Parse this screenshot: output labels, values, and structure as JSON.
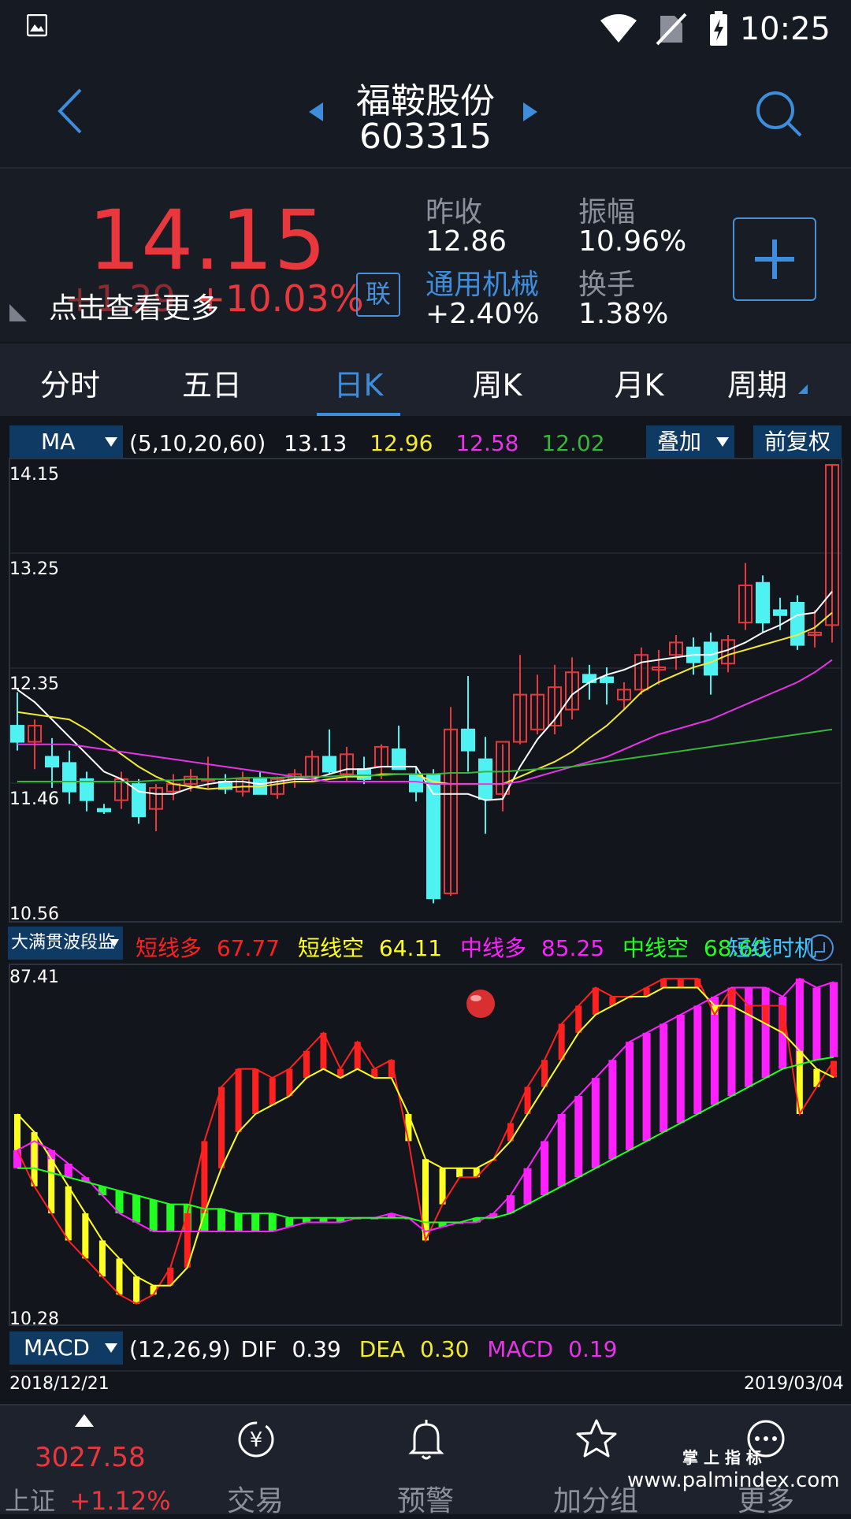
{
  "status": {
    "time": "10:25"
  },
  "header": {
    "name": "福鞍股份",
    "code": "603315"
  },
  "quote": {
    "price": "14.15",
    "change": "+1.29",
    "change_pct": "+10.03%",
    "tip": "点击查看更多",
    "lian": "联",
    "prev_close_label": "昨收",
    "prev_close": "12.86",
    "amplitude_label": "振幅",
    "amplitude": "10.96%",
    "sector": "通用机械",
    "sector_pct": "+2.40%",
    "turnover_label": "换手",
    "turnover": "1.38%",
    "colors": {
      "up": "#e8383d",
      "accent": "#3e8ddc"
    }
  },
  "tabs": [
    {
      "label": "分时"
    },
    {
      "label": "五日"
    },
    {
      "label": "日K",
      "active": true
    },
    {
      "label": "周K"
    },
    {
      "label": "月K"
    },
    {
      "label": "周期"
    }
  ],
  "ma": {
    "selector": "MA",
    "params": "(5,10,20,60)",
    "v5": "13.13",
    "v10": "12.96",
    "v20": "12.58",
    "v60": "12.02",
    "overlay": "叠加",
    "adjust": "前复权"
  },
  "indicator": {
    "selector": "大满贯波段监",
    "items": [
      {
        "label": "短线多",
        "value": "67.77",
        "color": "#ff2020"
      },
      {
        "label": "短线空",
        "value": "64.11",
        "color": "#ffff20"
      },
      {
        "label": "中线多",
        "value": "85.25",
        "color": "#ff20ff"
      },
      {
        "label": "中线空",
        "value": "68.60",
        "color": "#20ff20"
      }
    ],
    "extra": "短线时机"
  },
  "macd": {
    "selector": "MACD",
    "params": "(12,26,9)",
    "dif_label": "DIF",
    "dif": "0.39",
    "dea_label": "DEA",
    "dea": "0.30",
    "macd_label": "MACD",
    "macd": "0.19"
  },
  "chart_data": [
    {
      "type": "candlestick",
      "y_ticks": [
        "14.15",
        "13.25",
        "12.35",
        "11.46",
        "10.56"
      ],
      "ylim": [
        10.56,
        14.15
      ],
      "x_start": "2018/12/21",
      "x_end": "2019/03/04",
      "candles": [
        {
          "o": 12.05,
          "h": 12.32,
          "l": 11.85,
          "c": 11.92
        },
        {
          "o": 11.92,
          "h": 12.1,
          "l": 11.7,
          "c": 12.05
        },
        {
          "o": 11.8,
          "h": 11.95,
          "l": 11.55,
          "c": 11.72
        },
        {
          "o": 11.75,
          "h": 11.85,
          "l": 11.42,
          "c": 11.52
        },
        {
          "o": 11.62,
          "h": 11.68,
          "l": 11.36,
          "c": 11.45
        },
        {
          "o": 11.38,
          "h": 11.42,
          "l": 11.34,
          "c": 11.36
        },
        {
          "o": 11.45,
          "h": 11.68,
          "l": 11.38,
          "c": 11.62
        },
        {
          "o": 11.58,
          "h": 11.62,
          "l": 11.26,
          "c": 11.32
        },
        {
          "o": 11.38,
          "h": 11.58,
          "l": 11.2,
          "c": 11.55
        },
        {
          "o": 11.52,
          "h": 11.66,
          "l": 11.45,
          "c": 11.58
        },
        {
          "o": 11.58,
          "h": 11.7,
          "l": 11.52,
          "c": 11.64
        },
        {
          "o": 11.62,
          "h": 11.8,
          "l": 11.55,
          "c": 11.62
        },
        {
          "o": 11.6,
          "h": 11.66,
          "l": 11.5,
          "c": 11.54
        },
        {
          "o": 11.52,
          "h": 11.68,
          "l": 11.48,
          "c": 11.62
        },
        {
          "o": 11.62,
          "h": 11.68,
          "l": 11.5,
          "c": 11.5
        },
        {
          "o": 11.5,
          "h": 11.64,
          "l": 11.46,
          "c": 11.62
        },
        {
          "o": 11.62,
          "h": 11.7,
          "l": 11.55,
          "c": 11.66
        },
        {
          "o": 11.64,
          "h": 11.85,
          "l": 11.6,
          "c": 11.8
        },
        {
          "o": 11.8,
          "h": 12.02,
          "l": 11.66,
          "c": 11.68
        },
        {
          "o": 11.66,
          "h": 11.88,
          "l": 11.6,
          "c": 11.82
        },
        {
          "o": 11.7,
          "h": 11.8,
          "l": 11.58,
          "c": 11.62
        },
        {
          "o": 11.72,
          "h": 11.9,
          "l": 11.62,
          "c": 11.88
        },
        {
          "o": 11.86,
          "h": 12.05,
          "l": 11.72,
          "c": 11.7
        },
        {
          "o": 11.66,
          "h": 11.72,
          "l": 11.44,
          "c": 11.52
        },
        {
          "o": 11.66,
          "h": 11.7,
          "l": 10.62,
          "c": 10.66
        },
        {
          "o": 10.7,
          "h": 12.2,
          "l": 10.68,
          "c": 12.02
        },
        {
          "o": 12.02,
          "h": 12.45,
          "l": 11.68,
          "c": 11.85
        },
        {
          "o": 11.78,
          "h": 11.96,
          "l": 11.18,
          "c": 11.46
        },
        {
          "o": 11.5,
          "h": 11.9,
          "l": 11.36,
          "c": 11.92
        },
        {
          "o": 11.92,
          "h": 12.62,
          "l": 11.9,
          "c": 12.3
        },
        {
          "o": 12.02,
          "h": 12.46,
          "l": 11.98,
          "c": 12.3
        },
        {
          "o": 12.05,
          "h": 12.54,
          "l": 11.98,
          "c": 12.36
        },
        {
          "o": 12.18,
          "h": 12.6,
          "l": 12.1,
          "c": 12.48
        },
        {
          "o": 12.46,
          "h": 12.54,
          "l": 12.26,
          "c": 12.4
        },
        {
          "o": 12.44,
          "h": 12.52,
          "l": 12.22,
          "c": 12.4
        },
        {
          "o": 12.26,
          "h": 12.4,
          "l": 12.18,
          "c": 12.34
        },
        {
          "o": 12.34,
          "h": 12.68,
          "l": 12.3,
          "c": 12.62
        },
        {
          "o": 12.5,
          "h": 12.66,
          "l": 12.38,
          "c": 12.52
        },
        {
          "o": 12.62,
          "h": 12.78,
          "l": 12.5,
          "c": 12.72
        },
        {
          "o": 12.68,
          "h": 12.76,
          "l": 12.46,
          "c": 12.56
        },
        {
          "o": 12.72,
          "h": 12.8,
          "l": 12.3,
          "c": 12.46
        },
        {
          "o": 12.55,
          "h": 12.78,
          "l": 12.48,
          "c": 12.74
        },
        {
          "o": 12.88,
          "h": 13.36,
          "l": 12.82,
          "c": 13.18
        },
        {
          "o": 13.2,
          "h": 13.26,
          "l": 12.8,
          "c": 12.88
        },
        {
          "o": 12.98,
          "h": 13.08,
          "l": 12.82,
          "c": 12.94
        },
        {
          "o": 13.04,
          "h": 13.1,
          "l": 12.66,
          "c": 12.7
        },
        {
          "o": 12.78,
          "h": 12.98,
          "l": 12.68,
          "c": 12.8
        },
        {
          "o": 12.86,
          "h": 14.15,
          "l": 12.72,
          "c": 14.15
        }
      ],
      "ma_series": [
        {
          "name": "MA5",
          "values": [
            12.34,
            12.24,
            12.1,
            11.96,
            11.82,
            11.68,
            11.62,
            11.52,
            11.5,
            11.5,
            11.55,
            11.58,
            11.6,
            11.6,
            11.58,
            11.6,
            11.62,
            11.62,
            11.66,
            11.7,
            11.7,
            11.72,
            11.72,
            11.72,
            11.5,
            11.5,
            11.5,
            11.45,
            11.46,
            11.72,
            11.94,
            12.1,
            12.3,
            12.4,
            12.46,
            12.5,
            12.56,
            12.58,
            12.6,
            12.62,
            12.62,
            12.66,
            12.72,
            12.8,
            12.86,
            12.94,
            12.96,
            13.13
          ]
        },
        {
          "name": "MA10",
          "values": [
            12.16,
            12.14,
            12.12,
            12.1,
            12.02,
            11.92,
            11.82,
            11.72,
            11.64,
            11.58,
            11.56,
            11.54,
            11.55,
            11.56,
            11.56,
            11.58,
            11.6,
            11.6,
            11.62,
            11.64,
            11.64,
            11.66,
            11.66,
            11.66,
            11.6,
            11.58,
            11.58,
            11.58,
            11.58,
            11.64,
            11.7,
            11.76,
            11.84,
            11.95,
            12.05,
            12.18,
            12.32,
            12.4,
            12.46,
            12.52,
            12.56,
            12.62,
            12.66,
            12.7,
            12.74,
            12.78,
            12.84,
            12.96
          ]
        },
        {
          "name": "MA20",
          "values": [
            11.9,
            11.9,
            11.9,
            11.9,
            11.88,
            11.86,
            11.84,
            11.82,
            11.8,
            11.78,
            11.76,
            11.74,
            11.72,
            11.7,
            11.68,
            11.66,
            11.64,
            11.62,
            11.6,
            11.6,
            11.6,
            11.6,
            11.6,
            11.6,
            11.58,
            11.58,
            11.58,
            11.58,
            11.58,
            11.6,
            11.64,
            11.68,
            11.72,
            11.76,
            11.8,
            11.86,
            11.92,
            11.98,
            12.02,
            12.06,
            12.1,
            12.16,
            12.22,
            12.28,
            12.34,
            12.4,
            12.48,
            12.58
          ]
        },
        {
          "name": "MA60",
          "values": [
            11.6,
            11.6,
            11.6,
            11.6,
            11.6,
            11.6,
            11.6,
            11.6,
            11.61,
            11.61,
            11.62,
            11.62,
            11.62,
            11.63,
            11.63,
            11.63,
            11.64,
            11.64,
            11.64,
            11.65,
            11.65,
            11.65,
            11.66,
            11.66,
            11.66,
            11.67,
            11.67,
            11.68,
            11.68,
            11.69,
            11.7,
            11.71,
            11.72,
            11.74,
            11.76,
            11.78,
            11.8,
            11.82,
            11.84,
            11.86,
            11.88,
            11.9,
            11.92,
            11.94,
            11.96,
            11.98,
            12.0,
            12.02
          ]
        }
      ]
    },
    {
      "type": "bar",
      "title": "",
      "y_ticks": [
        "87.41",
        "10.28"
      ],
      "ylim": [
        10.28,
        87.41
      ],
      "series": [
        {
          "name": "短线多",
          "values": [
            48,
            40,
            34,
            28,
            24,
            20,
            16,
            14,
            16,
            22,
            34,
            50,
            62,
            66,
            66,
            64,
            66,
            70,
            74,
            66,
            72,
            66,
            68,
            50,
            28,
            36,
            42,
            42,
            46,
            54,
            62,
            68,
            76,
            80,
            84,
            82,
            82,
            84,
            86,
            86,
            86,
            78,
            84,
            80,
            80,
            80,
            56,
            62,
            67.77
          ]
        },
        {
          "name": "短线空",
          "values": [
            56,
            52,
            46,
            40,
            34,
            28,
            24,
            20,
            18,
            18,
            22,
            34,
            44,
            52,
            56,
            58,
            60,
            64,
            66,
            64,
            66,
            64,
            64,
            56,
            46,
            44,
            44,
            44,
            46,
            50,
            56,
            62,
            68,
            74,
            78,
            80,
            82,
            82,
            84,
            84,
            84,
            80,
            80,
            78,
            76,
            74,
            70,
            66,
            64.11
          ]
        },
        {
          "name": "中线多",
          "values": [
            48,
            50,
            48,
            45,
            42,
            38,
            34,
            32,
            30,
            30,
            30,
            30,
            30,
            30,
            30,
            30,
            31,
            32,
            32,
            32,
            33,
            33,
            34,
            33,
            30,
            31,
            32,
            32,
            34,
            38,
            44,
            50,
            56,
            60,
            64,
            68,
            72,
            74,
            76,
            78,
            80,
            82,
            84,
            84,
            84,
            82,
            86,
            84,
            85.25
          ]
        },
        {
          "name": "中线空",
          "values": [
            44,
            44,
            43,
            42,
            41,
            40,
            39,
            38,
            37,
            36,
            36,
            35,
            35,
            34,
            34,
            34,
            33,
            33,
            33,
            33,
            33,
            33,
            33,
            33,
            32,
            32,
            32,
            33,
            33,
            34,
            36,
            38,
            40,
            42,
            44,
            46,
            48,
            50,
            52,
            54,
            56,
            58,
            60,
            62,
            64,
            66,
            67,
            68,
            68.6
          ]
        }
      ]
    }
  ],
  "nav": {
    "index_value": "3027.58",
    "index_name": "上证",
    "index_pct": "+1.12%",
    "items": [
      {
        "label": "交易",
        "icon": "yen-icon"
      },
      {
        "label": "预警",
        "icon": "bell-icon"
      },
      {
        "label": "加分组",
        "icon": "star-icon"
      },
      {
        "label": "更多",
        "icon": "more-icon"
      }
    ],
    "watermark_top": "掌 上 指 标",
    "watermark_url": "www.palmindex.com"
  }
}
